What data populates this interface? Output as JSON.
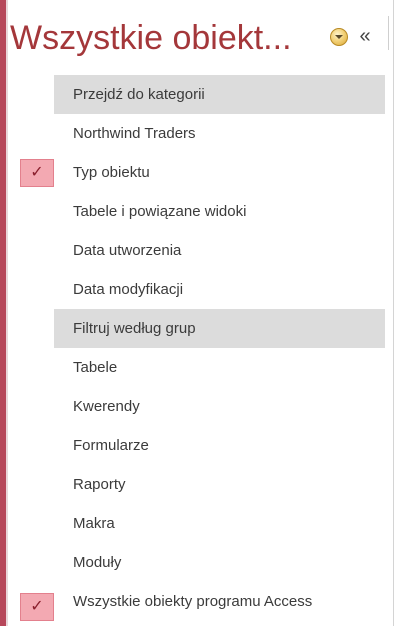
{
  "title": "Wszystkie obiekt...",
  "icons": {
    "dropdown": "dropdown-circle-icon",
    "collapse": "double-chevron-left-icon",
    "check": "checkmark-icon"
  },
  "collapse_glyph": "«",
  "check_glyph": "✓",
  "colors": {
    "accent": "#a4373a",
    "section_bg": "#dcdcdc",
    "check_bg": "#f3a9b2"
  },
  "menu": {
    "section_category": "Przejdź do kategorii",
    "northwind": "Northwind Traders",
    "typ_obiektu": "Typ obiektu",
    "tabele_widoki": "Tabele i powiązane widoki",
    "data_utworzenia": "Data utworzenia",
    "data_modyfikacji": "Data modyfikacji",
    "section_filter": "Filtruj według grup",
    "tabele": "Tabele",
    "kwerendy": "Kwerendy",
    "formularze": "Formularze",
    "raporty": "Raporty",
    "makra": "Makra",
    "moduly": "Moduły",
    "wszystkie": "Wszystkie obiekty programu Access"
  },
  "checked": [
    "typ_obiektu",
    "wszystkie"
  ]
}
